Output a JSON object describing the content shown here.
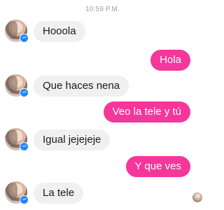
{
  "header": {
    "timestamp": "10:59 P.M."
  },
  "messages": [
    {
      "sender": "contact",
      "text": "Hooola"
    },
    {
      "sender": "me",
      "text": "Hola"
    },
    {
      "sender": "contact",
      "text": "Que haces nena"
    },
    {
      "sender": "me",
      "text": "Veo la tele y tú"
    },
    {
      "sender": "contact",
      "text": "Igual jejejeje"
    },
    {
      "sender": "me",
      "text": "Y que ves"
    },
    {
      "sender": "contact",
      "text": "La tele"
    }
  ],
  "colors": {
    "outgoing_bubble": "#f5369a",
    "incoming_bubble": "#f1f0f0",
    "messenger_badge": "#1e88ff"
  },
  "icons": {
    "contact_avatar": "avatar-photo-icon",
    "messenger_badge": "messenger-badge-icon",
    "seen_indicator": "seen-avatar-icon"
  }
}
